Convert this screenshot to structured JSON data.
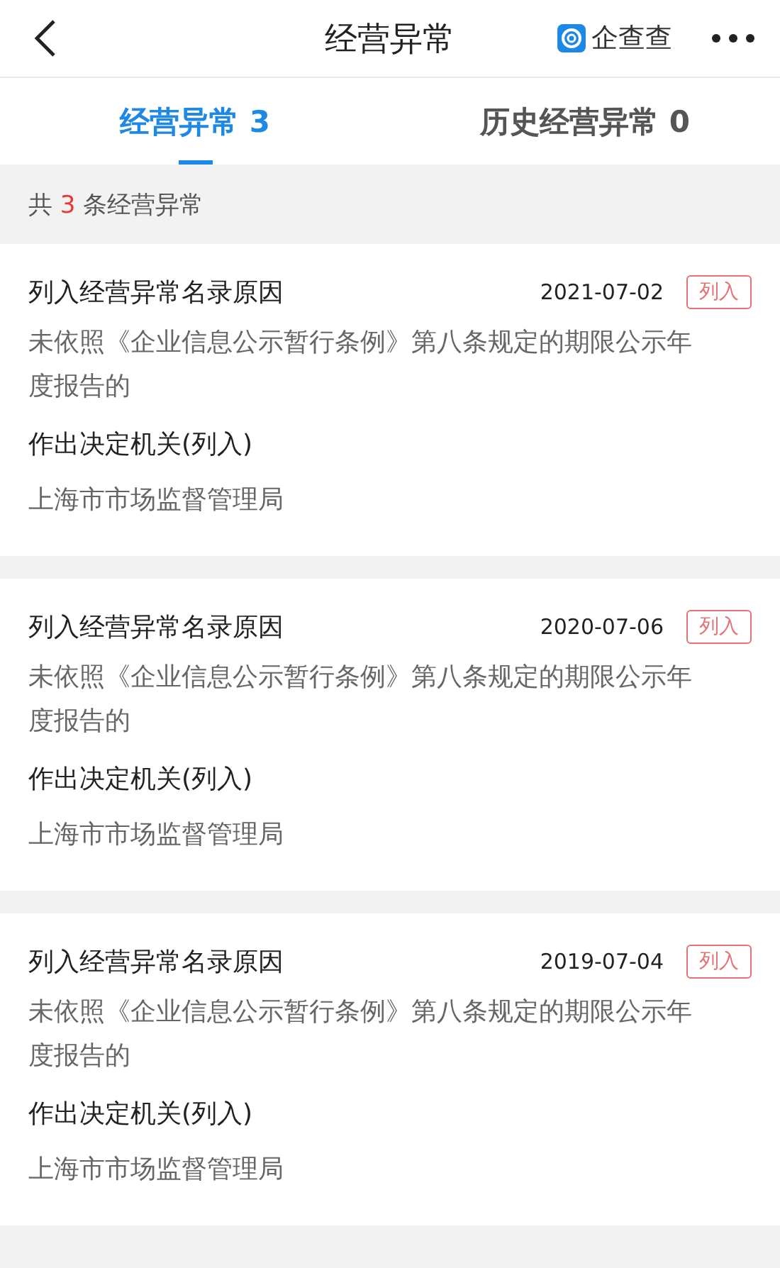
{
  "nav_bar": {
    "title": "经营异常",
    "brand": "企查查"
  },
  "tabs": [
    {
      "label": "经营异常 3",
      "selected": true
    },
    {
      "label": "历史经营异常 0",
      "selected": false
    }
  ],
  "summary": {
    "prefix": "共",
    "count": "3",
    "suffix": "条经营异常"
  },
  "records": [
    {
      "reason_label": "列入经营异常名录原因",
      "date": "2021-07-02",
      "tag": "列入",
      "reason": "未依照《企业信息公示暂行条例》第八条规定的期限公示年度报告的",
      "authority_label": "作出决定机关(列入)",
      "authority": "上海市市场监督管理局"
    },
    {
      "reason_label": "列入经营异常名录原因",
      "date": "2020-07-06",
      "tag": "列入",
      "reason": "未依照《企业信息公示暂行条例》第八条规定的期限公示年度报告的",
      "authority_label": "作出决定机关(列入)",
      "authority": "上海市市场监督管理局"
    },
    {
      "reason_label": "列入经营异常名录原因",
      "date": "2019-07-04",
      "tag": "列入",
      "reason": "未依照《企业信息公示暂行条例》第八条规定的期限公示年度报告的",
      "authority_label": "作出决定机关(列入)",
      "authority": "上海市市场监督管理局"
    }
  ]
}
